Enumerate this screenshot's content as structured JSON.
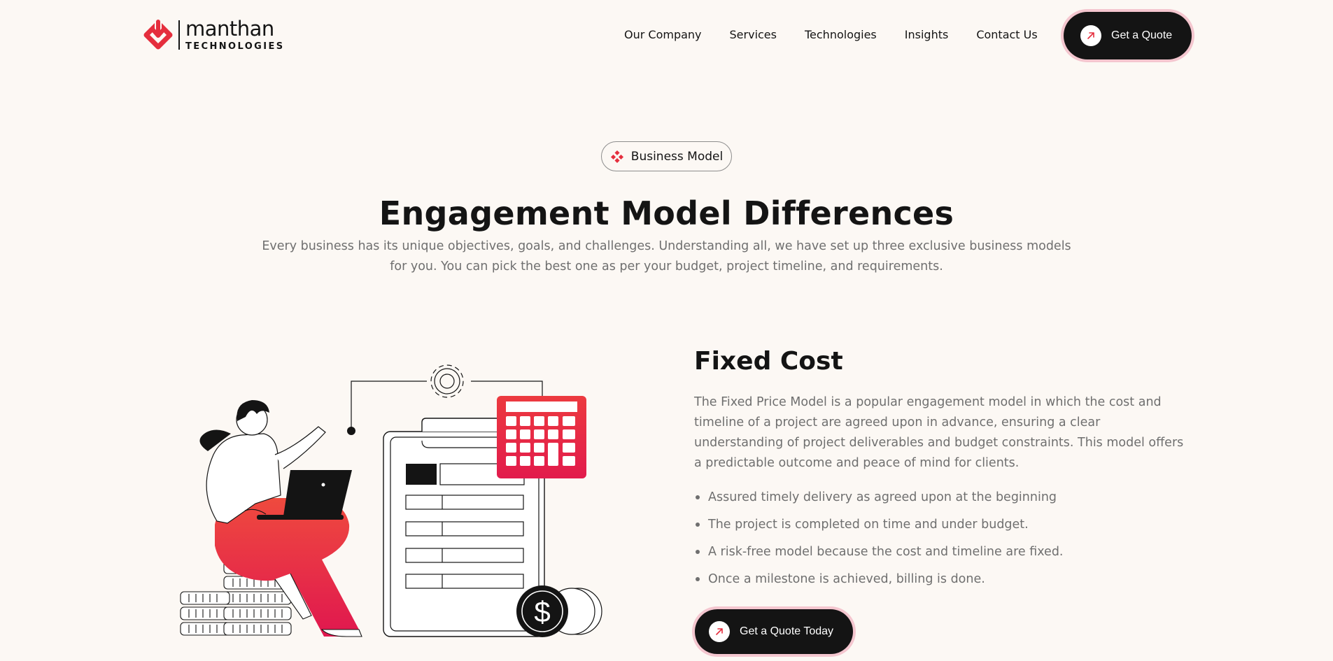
{
  "header": {
    "logo": {
      "word": "manthan",
      "sub": "TECHNOLOGIES"
    },
    "nav": [
      {
        "label": "Our Company"
      },
      {
        "label": "Services"
      },
      {
        "label": "Technologies"
      },
      {
        "label": "Insights"
      },
      {
        "label": "Contact Us"
      }
    ],
    "cta_label": "Get a Quote"
  },
  "section": {
    "badge": "Business Model",
    "title": "Engagement Model Differences",
    "subtitle": "Every business has its unique objectives, goals, and challenges. Understanding all, we have set up three exclusive business models for you. You can pick the best one as per your budget, project timeline, and requirements."
  },
  "model": {
    "title": "Fixed Cost",
    "description": "The Fixed Price Model is a popular engagement model in which the cost and timeline of a project are agreed upon in advance, ensuring a clear understanding of project deliverables and budget constraints. This model offers a predictable outcome and peace of mind for clients.",
    "bullets": [
      "Assured timely delivery as agreed upon at the beginning",
      "The project is completed on time and under budget.",
      "A risk-free model because the cost and timeline are fixed.",
      "Once a milestone is achieved, billing is done."
    ],
    "cta_label": "Get a Quote Today",
    "illustration": {
      "coin_symbol": "$"
    }
  },
  "colors": {
    "background": "#fcf8f4",
    "brand_red": "#e52e3d",
    "button_dark": "#141414",
    "button_ring": "#f4c6cf",
    "muted_text": "#6f6f6f"
  },
  "icons": {
    "logo": "manthan-logo-icon",
    "arrow": "arrow-up-right-icon",
    "badge": "brand-dots-icon"
  }
}
